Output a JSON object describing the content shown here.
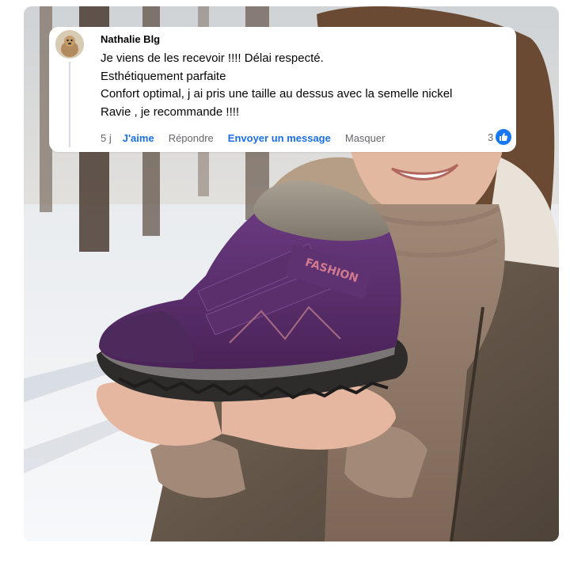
{
  "comment": {
    "author": "Nathalie Blg",
    "lines": [
      "Je viens de les recevoir !!!! Délai respecté.",
      "Esthétiquement parfaite",
      "Confort optimal, j ai pris une taille au dessus avec la semelle nickel",
      "Ravie , je recommande !!!!"
    ],
    "time": "5 j",
    "like_label": "J'aime",
    "reply_label": "Répondre",
    "message_label": "Envoyer un message",
    "hide_label": "Masquer",
    "reaction_count": "3"
  },
  "photo": {
    "shoe_brand_text": "FASHION",
    "colors": {
      "shoe_purple": "#5b2f6e",
      "sole_grey": "#6e6e70",
      "accent_blue": "#1877f2"
    }
  }
}
